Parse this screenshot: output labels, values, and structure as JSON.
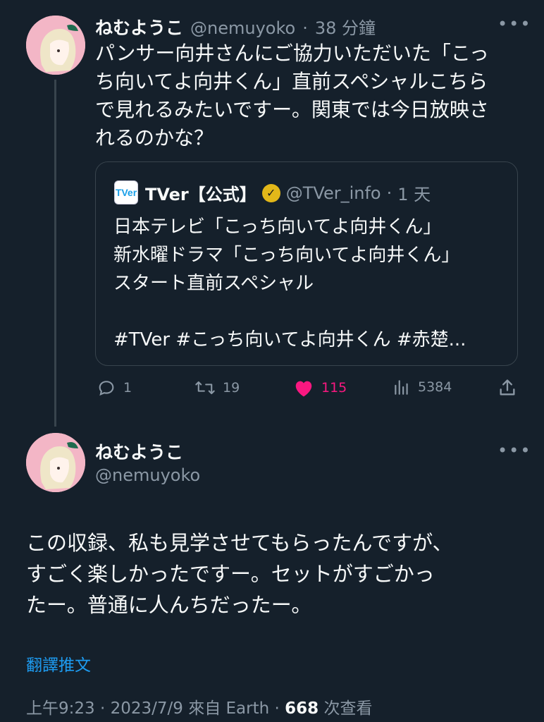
{
  "tweet1": {
    "name": "ねむようこ",
    "handle": "@nemuyoko",
    "time": "38 分鐘",
    "text": "パンサー向井さんにご協力いただいた「こっ\nち向いてよ向井くん」直前スペシャルこちら\nで見れるみたいですー。関東では今日放映さ\nれるのかな？",
    "quote": {
      "logo": "TVer",
      "name": "TVer【公式】",
      "handle": "@TVer_info",
      "time": "1 天",
      "text": "日本テレビ「こっち向いてよ向井くん」\n新水曜ドラマ「こっち向いてよ向井くん」\nスタート直前スペシャル\n\n#TVer #こっち向いてよ向井くん #赤楚..."
    },
    "actions": {
      "replies": "1",
      "retweets": "19",
      "likes": "115",
      "views": "5384"
    }
  },
  "tweet2": {
    "name": "ねむようこ",
    "handle": "@nemuyoko",
    "text": "この収録、私も見学させてもらったんですが、\nすごく楽しかったですー。セットがすごかっ\nたー。普通に人んちだったー。",
    "translate": "翻譯推文",
    "meta_prefix": "上午9:23 · 2023/7/9 來自 Earth · ",
    "views_count": "668",
    "views_suffix": " 次查看"
  },
  "colors": {
    "background": "#15202b",
    "text": "#f7f9f9",
    "muted": "#8b98a5",
    "like": "#f91880",
    "link": "#1d9bf0",
    "verified": "#e2b719"
  },
  "icons": [
    "more-icon",
    "reply-icon",
    "retweet-icon",
    "heart-icon",
    "views-icon",
    "share-icon",
    "verified-badge-icon"
  ]
}
